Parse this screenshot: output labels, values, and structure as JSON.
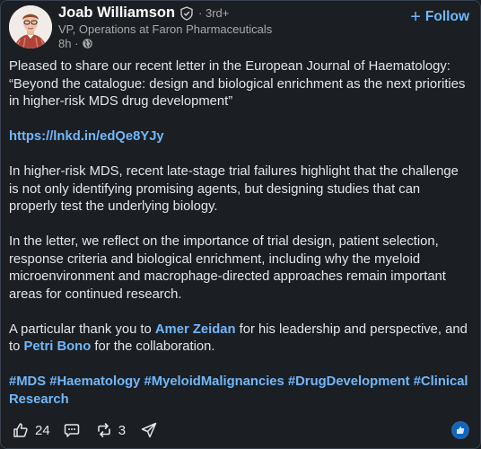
{
  "post": {
    "author": {
      "name": "Joab Williamson",
      "verified_icon": "verified-shield-icon",
      "degree": "· 3rd+",
      "headline": "VP, Operations at Faron Pharmaceuticals",
      "time": "8h ·",
      "visibility_icon": "globe-icon"
    },
    "follow_label": "Follow",
    "follow_icon": "plus-icon",
    "body": {
      "intro": "Pleased to share our recent letter in the European Journal of Haematology: “Beyond the catalogue: design and biological enrichment as the next priorities in higher-risk MDS drug development”",
      "link": "https://lnkd.in/edQe8YJy",
      "para2": "In higher-risk MDS, recent late-stage trial failures highlight that the challenge is not only identifying promising agents, but designing studies that can properly test the underlying biology.",
      "para3": "In the letter, we reflect on the importance of trial design, patient selection, response criteria and biological enrichment, including why the myeloid microenvironment and macrophage-directed approaches remain important areas for continued research.",
      "thanks_prefix": "A particular thank you to ",
      "mention1": "Amer Zeidan",
      "thanks_mid": " for his leadership and perspective, and to ",
      "mention2": "Petri Bono",
      "thanks_suffix": " for the collaboration.",
      "hashtags": [
        "#MDS",
        "#Haematology",
        "#MyeloidMalignancies",
        "#DrugDevelopment",
        "#ClinicalResearch"
      ]
    },
    "actions": {
      "like_count": "24",
      "repost_count": "3",
      "icons": [
        "thumbs-up-icon",
        "comment-icon",
        "repost-icon",
        "send-icon"
      ]
    },
    "colors": {
      "background": "#1b1f23",
      "accent": "#71b7fb",
      "text": "#e4e6e8",
      "muted": "#a8a9aa"
    }
  }
}
